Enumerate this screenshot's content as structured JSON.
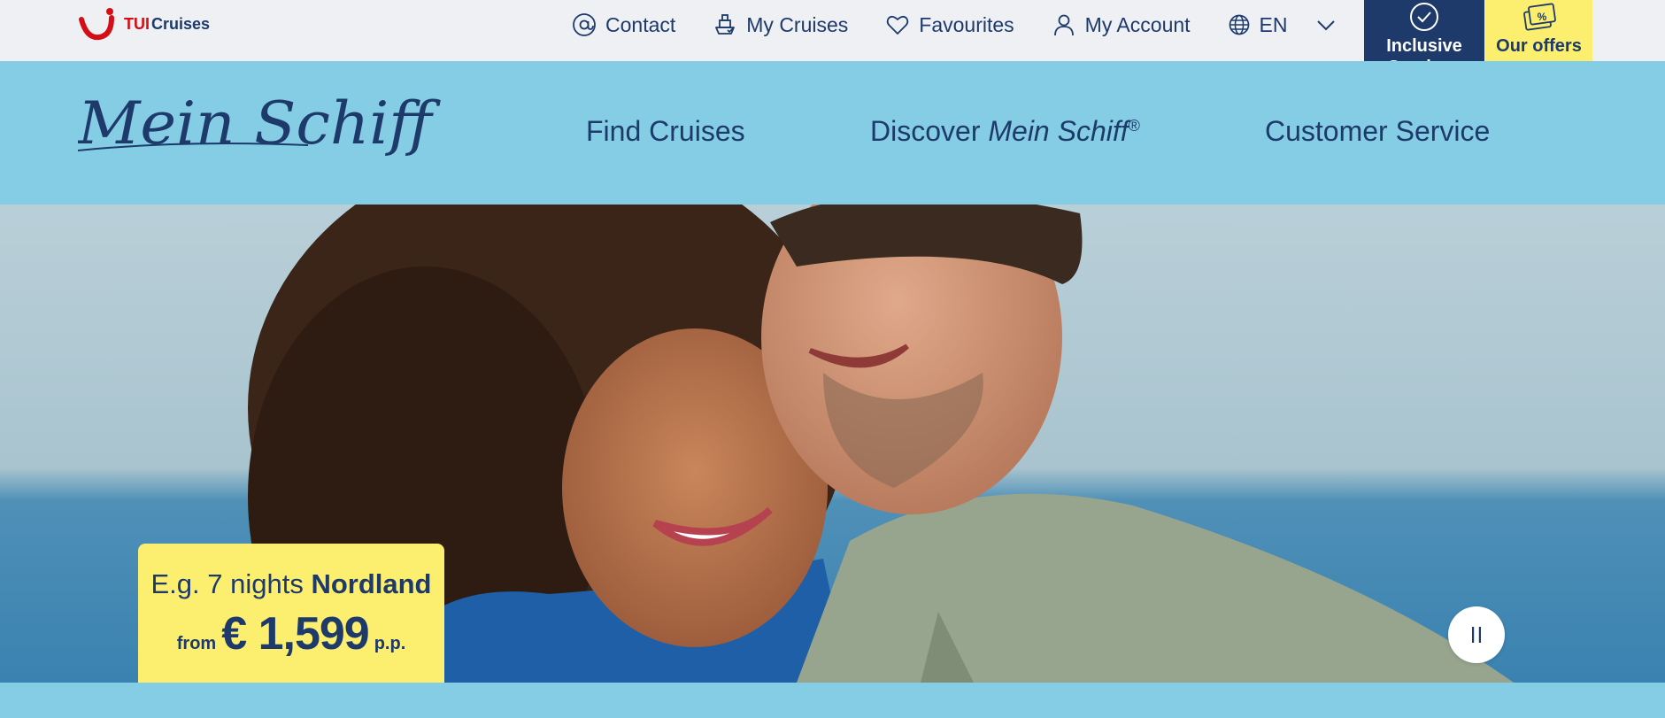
{
  "brand": {
    "tui": "TUI",
    "cruises": "Cruises",
    "script_logo": "Mein Schiff"
  },
  "utility_nav": {
    "contact": "Contact",
    "my_cruises": "My Cruises",
    "favourites": "Favourites",
    "my_account": "My Account",
    "language": "EN"
  },
  "tiles": {
    "inclusive": "Inclusive Services",
    "offers": "Our offers"
  },
  "main_nav": {
    "find": "Find Cruises",
    "discover_prefix": "Discover ",
    "discover_brand": "Mein Schiff",
    "discover_mark": "®",
    "service": "Customer Service"
  },
  "offer": {
    "prefix": "E.g. 7 nights ",
    "destination": "Nordland",
    "from": "from",
    "price": "€ 1,599",
    "per": "p.p."
  },
  "colors": {
    "navy": "#1d3a6b",
    "sky": "#84cde4",
    "yellow": "#fcef6f",
    "tui_red": "#d40e14",
    "topbar": "#eef0f4"
  },
  "icons": {
    "contact": "at-sign-icon",
    "my_cruises": "ship-icon",
    "favourites": "heart-icon",
    "my_account": "user-icon",
    "language": "globe-icon",
    "language_toggle": "chevron-down-icon",
    "inclusive": "check-circle-icon",
    "offers": "percent-tag-icon",
    "hero_control": "pause-icon"
  }
}
